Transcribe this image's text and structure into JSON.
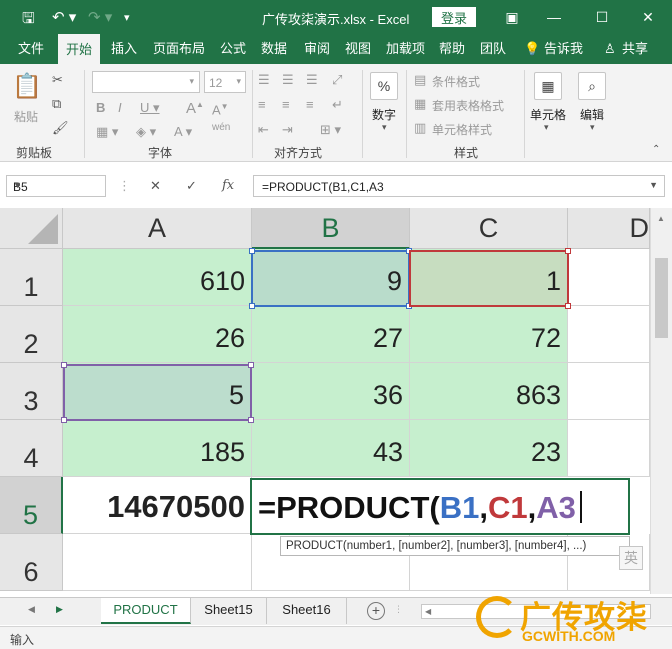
{
  "titlebar": {
    "title": "广传攻柒演示.xlsx  -  Excel",
    "login": "登录"
  },
  "tabs": [
    "文件",
    "开始",
    "插入",
    "页面布局",
    "公式",
    "数据",
    "审阅",
    "视图",
    "加载项",
    "帮助",
    "团队"
  ],
  "tabs_active": "开始",
  "tell_me": "告诉我",
  "share": "共享",
  "ribbon": {
    "paste": "粘贴",
    "clipboard": "剪贴板",
    "font_size": "12",
    "font": "字体",
    "wen": "wén",
    "align": "对齐方式",
    "number": "数字",
    "cond_format": "条件格式",
    "table_format": "套用表格格式",
    "cell_style": "单元格样式",
    "styles": "样式",
    "cells": "单元格",
    "edit": "编辑"
  },
  "formula_bar": {
    "name_box": "B5",
    "fx": "fx",
    "formula": "=PRODUCT(B1,C1,A3"
  },
  "columns": [
    "A",
    "B",
    "C",
    "D"
  ],
  "rows": [
    "1",
    "2",
    "3",
    "4",
    "5",
    "6"
  ],
  "cells": {
    "A1": "610",
    "B1": "9",
    "C1": "1",
    "A2": "26",
    "B2": "27",
    "C2": "72",
    "A3": "5",
    "B3": "36",
    "C3": "863",
    "A4": "185",
    "B4": "43",
    "C4": "23",
    "A5": "14670500"
  },
  "edit_tokens": {
    "prefix": "=PRODUCT(",
    "b1": "B1",
    "c1": "C1",
    "a3": "A3",
    "comma": ","
  },
  "tooltip": "PRODUCT(number1, [number2], [number3], [number4], ...)",
  "ime": "英",
  "sheets": [
    "PRODUCT",
    "Sheet15",
    "Sheet16"
  ],
  "active_sheet": "PRODUCT",
  "status": "输入",
  "watermark": {
    "main": "广传攻柒",
    "sub": "GCWITH.COM"
  },
  "colors": {
    "excel_green": "#217346",
    "ref_b1": "#3a70c4",
    "ref_c1": "#c0393b",
    "ref_a3": "#8060a8",
    "cell_fill": "#c6efce"
  }
}
